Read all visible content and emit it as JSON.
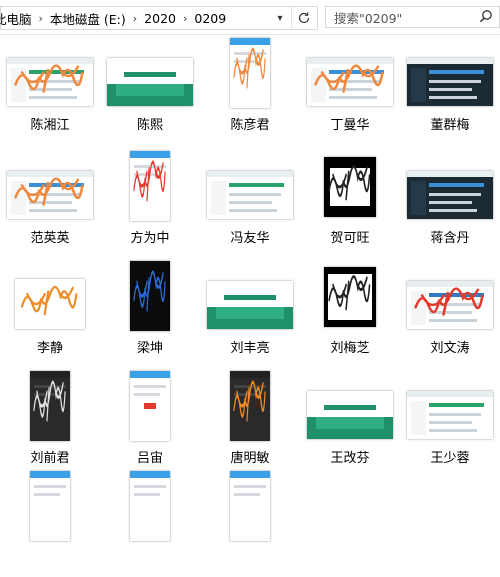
{
  "addressbar": {
    "crumbs": [
      "此电脑",
      "本地磁盘 (E:)",
      "2020",
      "0209"
    ],
    "search_placeholder": "搜索\"0209\""
  },
  "files": [
    {
      "name": "陈湘江",
      "type": "screen-orange"
    },
    {
      "name": "陈熙",
      "type": "slide-teal"
    },
    {
      "name": "陈彦君",
      "type": "phone-sign-orange"
    },
    {
      "name": "丁曼华",
      "type": "screen-sign-orange"
    },
    {
      "name": "董群梅",
      "type": "screen-dark"
    },
    {
      "name": "范英英",
      "type": "screen-sign-orange"
    },
    {
      "name": "方为中",
      "type": "phone-sign-red"
    },
    {
      "name": "冯友华",
      "type": "screen-light"
    },
    {
      "name": "贺可旺",
      "type": "paper-black-sign"
    },
    {
      "name": "蒋含丹",
      "type": "screen-dark"
    },
    {
      "name": "李静",
      "type": "sign-orange"
    },
    {
      "name": "梁坤",
      "type": "phone-black-blue"
    },
    {
      "name": "刘丰亮",
      "type": "slide-teal"
    },
    {
      "name": "刘梅芝",
      "type": "paper-sign"
    },
    {
      "name": "刘文涛",
      "type": "screen-sign-red"
    },
    {
      "name": "刘前君",
      "type": "phone-dark-sign"
    },
    {
      "name": "吕宙",
      "type": "phone-white-red"
    },
    {
      "name": "唐明敏",
      "type": "phone-dark-orange"
    },
    {
      "name": "王改芬",
      "type": "slide-teal"
    },
    {
      "name": "王少蓉",
      "type": "screen-light"
    },
    {
      "name": "",
      "type": "phone-white"
    },
    {
      "name": "",
      "type": "phone-white"
    },
    {
      "name": "",
      "type": "phone-white"
    }
  ]
}
